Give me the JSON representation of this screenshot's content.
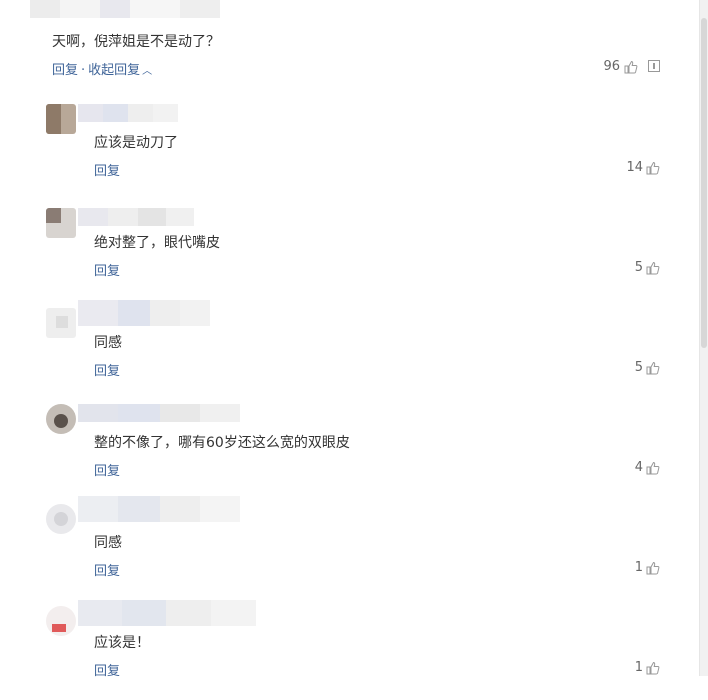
{
  "root": {
    "text": "天啊，倪萍姐是不是动了？",
    "reply_label": "回复",
    "separator": "·",
    "collapse_label": "收起回复",
    "likes": "96"
  },
  "replies": [
    {
      "text": "应该是动刀了",
      "reply_label": "回复",
      "likes": "14"
    },
    {
      "text": "绝对整了，眼代嘴皮",
      "reply_label": "回复",
      "likes": "5"
    },
    {
      "text": "同感",
      "reply_label": "回复",
      "likes": "5"
    },
    {
      "text": "整的不像了，哪有60岁还这么宽的双眼皮",
      "reply_label": "回复",
      "likes": "4"
    },
    {
      "text": "同感",
      "reply_label": "回复",
      "likes": "1"
    },
    {
      "text": "应该是！",
      "reply_label": "回复",
      "likes": "1"
    }
  ],
  "icons": {
    "like": "thumbs-up-icon",
    "report": "report-icon",
    "collapse": "chevron-up-icon"
  },
  "colors": {
    "link": "#406599",
    "text": "#333333",
    "count": "#666666"
  }
}
